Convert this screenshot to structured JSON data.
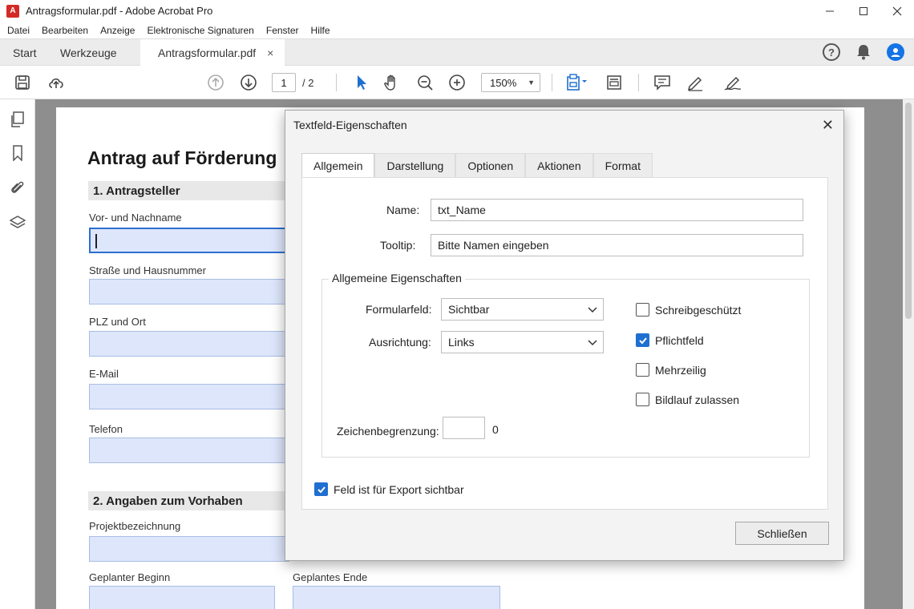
{
  "window": {
    "title": "Antragsformular.pdf - Adobe Acrobat Pro",
    "controls": [
      "minimize",
      "maximize",
      "close"
    ]
  },
  "menu": [
    "Datei",
    "Bearbeiten",
    "Anzeige",
    "Elektronische Signaturen",
    "Fenster",
    "Hilfe"
  ],
  "tabs": {
    "start": "Start",
    "tools": "Werkzeuge",
    "document": "Antragsformular.pdf",
    "close_glyph": "×"
  },
  "toolbar": {
    "current_page": "1",
    "page_total": "/  2",
    "zoom": "150%"
  },
  "document": {
    "title": "Antrag auf Förderung",
    "section1": "1.  Antragsteller",
    "section2": "2.  Angaben zum Vorhaben",
    "fields": {
      "name": "Vor- und Nachname",
      "street": "Straße und Hausnummer",
      "city": "PLZ und Ort",
      "email": "E-Mail",
      "phone": "Telefon",
      "project": "Projektbezeichnung",
      "start": "Geplanter Beginn",
      "end": "Geplantes Ende"
    }
  },
  "dialog": {
    "title": "Textfeld-Eigenschaften",
    "tabs": [
      "Allgemein",
      "Darstellung",
      "Optionen",
      "Aktionen",
      "Format"
    ],
    "active_tab": "Allgemein",
    "name_label": "Name:",
    "name_value": "txt_Name",
    "tooltip_label": "Tooltip:",
    "tooltip_value": "Bitte Namen eingeben",
    "group_title": "Allgemeine Eigenschaften",
    "formfield_label": "Formularfeld:",
    "formfield_value": "Sichtbar",
    "alignment_label": "Ausrichtung:",
    "alignment_value": "Links",
    "charlimit_label": "Zeichenbegrenzung:",
    "charlimit_value": "",
    "charlimit_count": "0",
    "checkboxes": {
      "readonly": {
        "label": "Schreibgeschützt",
        "checked": false
      },
      "required": {
        "label": "Pflichtfeld",
        "checked": true
      },
      "multiline": {
        "label": "Mehrzeilig",
        "checked": false
      },
      "scroll": {
        "label": "Bildlauf zulassen",
        "checked": false
      }
    },
    "export_label": "Feld ist für Export sichtbar",
    "export_checked": true,
    "close_button": "Schließen",
    "close_glyph": "✕"
  },
  "colors": {
    "accent": "#1f6fd1",
    "field_fill": "#dde6fb",
    "acrobat_red": "#d42a25"
  }
}
